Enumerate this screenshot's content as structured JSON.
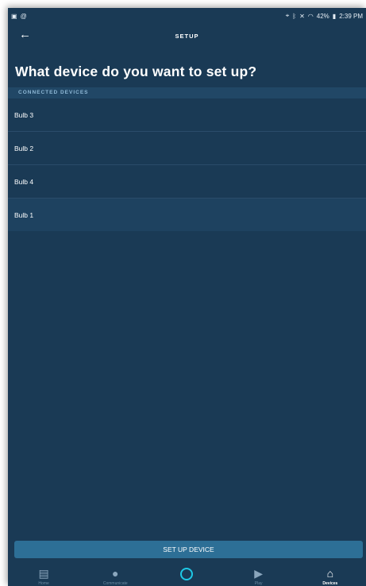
{
  "status_bar": {
    "left_icons": [
      "image-icon",
      "at-icon"
    ],
    "battery": "42%",
    "time": "2:39 PM"
  },
  "app_bar": {
    "title": "SETUP"
  },
  "page": {
    "heading": "What device do you want to set up?",
    "section_label": "CONNECTED DEVICES"
  },
  "devices": [
    {
      "name": "Bulb 3"
    },
    {
      "name": "Bulb 2"
    },
    {
      "name": "Bulb 4"
    },
    {
      "name": "Bulb 1"
    }
  ],
  "action": {
    "setup_label": "SET UP DEVICE"
  },
  "nav": [
    {
      "label": "Home",
      "icon": "home-icon"
    },
    {
      "label": "Communicate",
      "icon": "chat-bubble-icon"
    },
    {
      "label": "",
      "icon": "alexa-icon"
    },
    {
      "label": "Play",
      "icon": "play-icon"
    },
    {
      "label": "Devices",
      "icon": "devices-icon",
      "active": true
    }
  ],
  "colors": {
    "background": "#1a3a55",
    "section_header": "#214766",
    "selected_row": "#1e4260",
    "button": "#2d6f96",
    "alexa_ring": "#1ec9e6"
  }
}
